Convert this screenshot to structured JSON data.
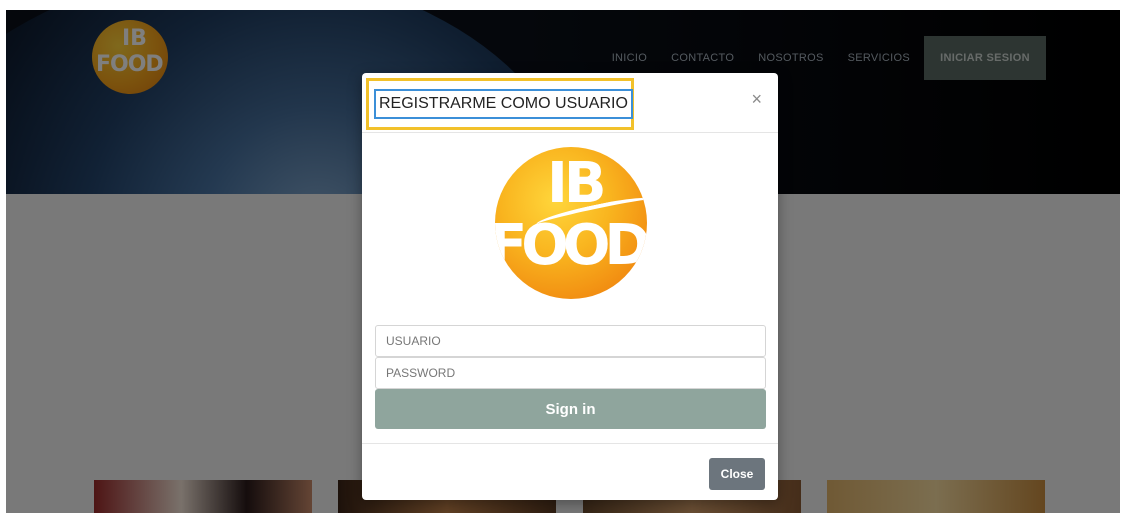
{
  "site": {
    "logo_text_top": "IB",
    "logo_text_bottom": "FOOD"
  },
  "nav": {
    "items": [
      {
        "label": "INICIO"
      },
      {
        "label": "CONTACTO"
      },
      {
        "label": "NOSOTROS"
      },
      {
        "label": "SERVICIOS"
      }
    ],
    "login_button": "INICIAR SESION"
  },
  "modal": {
    "title": "REGISTRARME COMO USUARIO",
    "close_glyph": "×",
    "logo_text_top": "IB",
    "logo_text_bottom": "FOOD",
    "username_placeholder": "USUARIO",
    "password_placeholder": "PASSWORD",
    "signin_label": "Sign in",
    "close_label": "Close"
  },
  "colors": {
    "accent_highlight": "#f2c12a",
    "signin_button": "#8fa59d",
    "close_button": "#6c757d",
    "login_button": "#5a6b65"
  },
  "icons": [
    "close-icon"
  ]
}
